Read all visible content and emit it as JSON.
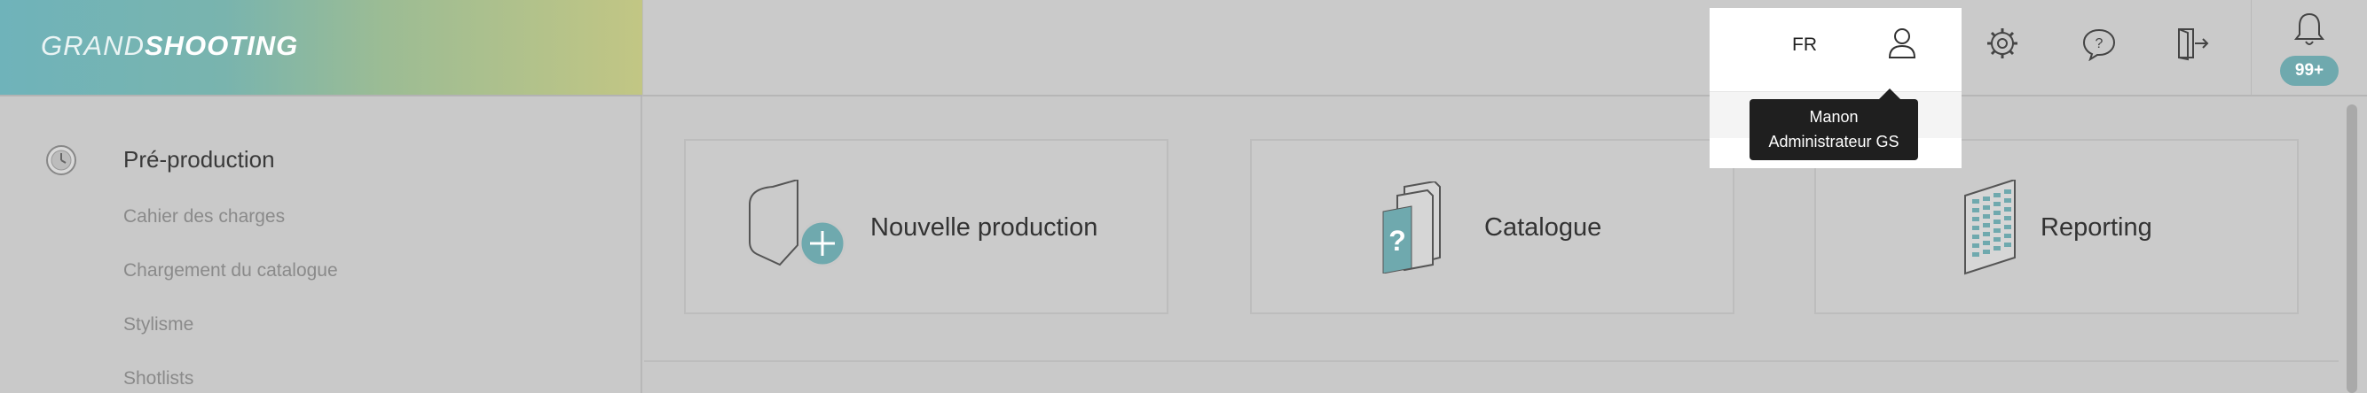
{
  "brand": {
    "part1": "GRAND",
    "part2": "SHOOTING"
  },
  "header": {
    "language": "FR",
    "notifications_badge": "99+"
  },
  "tooltip": {
    "name": "Manon",
    "role": "Administrateur GS"
  },
  "sidebar": {
    "section_title": "Pré-production",
    "items": [
      {
        "label": "Cahier des charges"
      },
      {
        "label": "Chargement du catalogue"
      },
      {
        "label": "Stylisme"
      },
      {
        "label": "Shotlists"
      }
    ]
  },
  "cards": [
    {
      "label": "Nouvelle production",
      "icon": "new-production-icon"
    },
    {
      "label": "Catalogue",
      "icon": "catalogue-icon"
    },
    {
      "label": "Reporting",
      "icon": "reporting-icon"
    }
  ],
  "colors": {
    "accent": "#6fa9ae",
    "tooltip_bg": "#1f1f1f",
    "background": "#c9c9c9"
  }
}
